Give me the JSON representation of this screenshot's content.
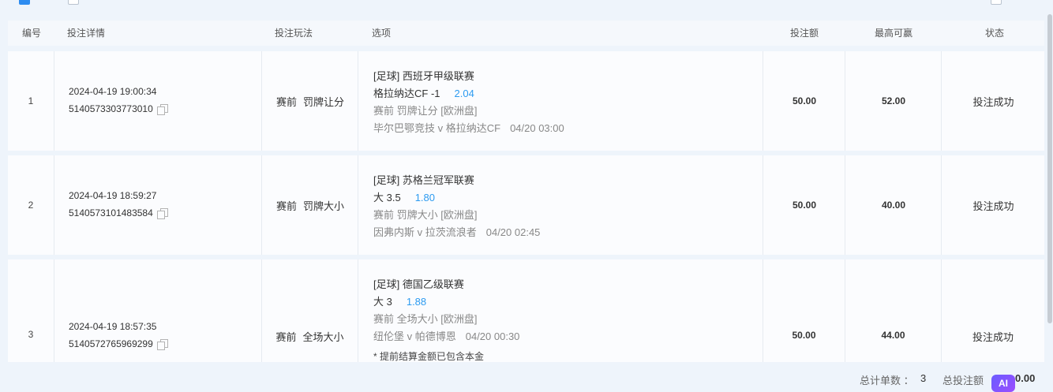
{
  "header": {
    "col_num": "编号",
    "col_detail": "投注详情",
    "col_play": "投注玩法",
    "col_option": "选项",
    "col_amount": "投注额",
    "col_max": "最高可赢",
    "col_status": "状态"
  },
  "rows": [
    {
      "num": "1",
      "datetime": "2024-04-19 19:00:34",
      "order_id": "5140573303773010",
      "play_a": "赛前",
      "play_b": "罚牌让分",
      "league": "[足球] 西班牙甲级联赛",
      "selection": "格拉纳达CF -1",
      "odds": "2.04",
      "market": "赛前 罚牌让分 [欧洲盘]",
      "match": "毕尔巴鄂竞技 v 格拉纳达CF",
      "match_time": "04/20 03:00",
      "amount": "50.00",
      "max_win": "52.00",
      "status": "投注成功"
    },
    {
      "num": "2",
      "datetime": "2024-04-19 18:59:27",
      "order_id": "5140573101483584",
      "play_a": "赛前",
      "play_b": "罚牌大小",
      "league": "[足球] 苏格兰冠军联赛",
      "selection": "大 3.5",
      "odds": "1.80",
      "market": "赛前 罚牌大小 [欧洲盘]",
      "match": "因弗内斯 v 拉茨流浪者",
      "match_time": "04/20 02:45",
      "amount": "50.00",
      "max_win": "40.00",
      "status": "投注成功"
    },
    {
      "num": "3",
      "datetime": "2024-04-19 18:57:35",
      "order_id": "5140572765969299",
      "play_a": "赛前",
      "play_b": "全场大小",
      "league": "[足球] 德国乙级联赛",
      "selection": "大 3",
      "odds": "1.88",
      "market": "赛前 全场大小 [欧洲盘]",
      "match": "纽伦堡 v 帕德博恩",
      "match_time": "04/20 00:30",
      "note": "* 提前结算金额已包含本金",
      "amount": "50.00",
      "max_win": "44.00",
      "status": "投注成功"
    }
  ],
  "footer": {
    "total_orders_label": "总计单数 ：",
    "total_orders": "3",
    "total_bet_label": "总投注额",
    "total_bet_visible": "0.00",
    "ai_badge": "AI"
  },
  "icons": {
    "copy": "copy-icon",
    "checkbox": "checkbox-icon"
  }
}
